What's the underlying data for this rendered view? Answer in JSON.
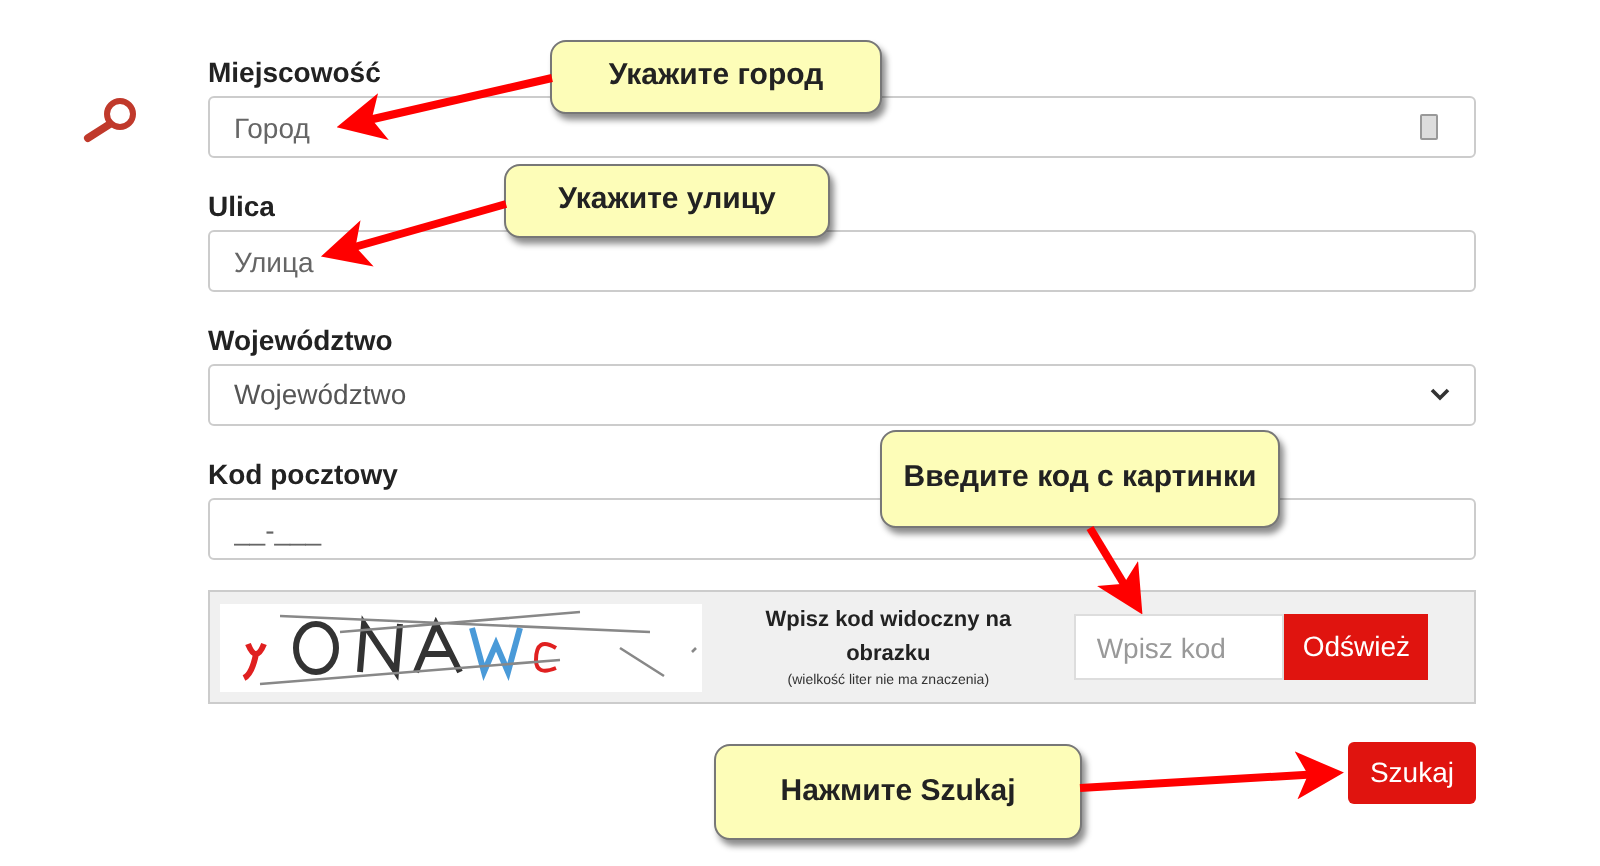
{
  "form": {
    "fields": [
      {
        "kind": "text",
        "label": "Miejscowość",
        "placeholder": "Город",
        "contact_icon": true
      },
      {
        "kind": "text",
        "label": "Ulica",
        "placeholder": "Улица",
        "contact_icon": false
      },
      {
        "kind": "select",
        "label": "Województwo",
        "value": "Województwo"
      },
      {
        "kind": "text",
        "label": "Kod pocztowy",
        "placeholder": "__-___",
        "contact_icon": false
      }
    ],
    "captcha": {
      "instruction": "Wpisz kod widoczny na obrazku",
      "note": "(wielkość liter nie ma znaczenia)",
      "placeholder": "Wpisz kod",
      "refresh_button": "Odśwież"
    },
    "submit_button": "Szukaj"
  },
  "annotations": [
    "Укажите город",
    "Укажите улицу",
    "Введите код с картинки",
    "Нажмите Szukaj"
  ]
}
